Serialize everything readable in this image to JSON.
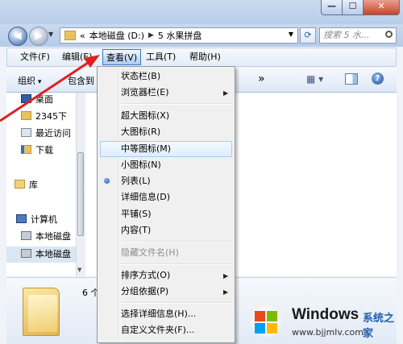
{
  "window": {
    "controls": {
      "minimize": "—",
      "maximize": "☐",
      "close": "✕"
    }
  },
  "address": {
    "prefix": "«",
    "segments": [
      "本地磁盘 (D:)",
      "5 水果拼盘"
    ],
    "search_placeholder": "搜索 5 水..."
  },
  "menubar": {
    "file": "文件(F)",
    "edit": "编辑(E)",
    "view": "查看(V)",
    "tools": "工具(T)",
    "help": "帮助(H)"
  },
  "toolbar": {
    "organize": "组织",
    "include": "包含到",
    "more": "»"
  },
  "nav_pane": {
    "items": [
      {
        "label": "桌面",
        "icon": "desktop-icon"
      },
      {
        "label": "2345下",
        "icon": "folder-icon"
      },
      {
        "label": "最近访问",
        "icon": "recent-places-icon"
      },
      {
        "label": "下载",
        "icon": "downloads-icon"
      },
      {
        "label": "库",
        "icon": "library-icon"
      },
      {
        "label": "计算机",
        "icon": "computer-icon"
      },
      {
        "label": "本地磁盘",
        "icon": "drive-icon"
      },
      {
        "label": "本地磁盘",
        "icon": "drive-icon"
      }
    ]
  },
  "details": {
    "count": "6 个"
  },
  "view_menu": {
    "items": [
      {
        "label": "状态栏(B)"
      },
      {
        "label": "浏览器栏(E)",
        "submenu": true
      },
      {
        "label": "超大图标(X)"
      },
      {
        "label": "大图标(R)"
      },
      {
        "label": "中等图标(M)",
        "highlighted": true
      },
      {
        "label": "小图标(N)"
      },
      {
        "label": "列表(L)",
        "selected": true
      },
      {
        "label": "详细信息(D)"
      },
      {
        "label": "平铺(S)"
      },
      {
        "label": "内容(T)"
      },
      {
        "label": "隐藏文件名(H)",
        "disabled": true
      },
      {
        "label": "排序方式(O)",
        "submenu": true
      },
      {
        "label": "分组依据(P)",
        "submenu": true
      },
      {
        "label": "选择详细信息(H)..."
      },
      {
        "label": "自定义文件夹(F)..."
      }
    ],
    "submenu_arrow": "▶"
  },
  "watermark": {
    "title": "Windows",
    "subtitle": "系统之家",
    "url": "www.bjjmlv.com"
  },
  "colors": {
    "accent": "#3b76c9",
    "annotation_arrow": "#e02020"
  }
}
